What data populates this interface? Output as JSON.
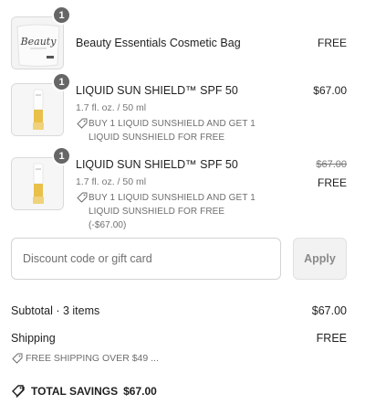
{
  "items": [
    {
      "name": "Beauty Essentials Cosmetic Bag",
      "quantity": "1",
      "price": "FREE",
      "thumb_text": "Beauty"
    },
    {
      "name": "LIQUID SUN SHIELD™ SPF 50",
      "quantity": "1",
      "variant": "1.7 fl. oz. / 50 ml",
      "promo": "BUY 1 LIQUID SUNSHIELD AND GET 1 LIQUID SUNSHIELD FOR FREE",
      "price": "$67.00"
    },
    {
      "name": "LIQUID SUN SHIELD™ SPF 50",
      "quantity": "1",
      "variant": "1.7 fl. oz. / 50 ml",
      "promo": "BUY 1 LIQUID SUNSHIELD AND GET 1 LIQUID SUNSHIELD FOR FREE (-$67.00)",
      "original_price": "$67.00",
      "price": "FREE"
    }
  ],
  "discount": {
    "placeholder": "Discount code or gift card",
    "apply_label": "Apply"
  },
  "summary": {
    "subtotal_label": "Subtotal · 3 items",
    "subtotal_value": "$67.00",
    "shipping_label": "Shipping",
    "shipping_value": "FREE",
    "shipping_promo": "FREE SHIPPING OVER $49 ...",
    "savings_label": "TOTAL SAVINGS",
    "savings_value": "$67.00"
  },
  "colors": {
    "badge": "#666666",
    "tube_accent": "#e8c04a",
    "border": "#d9d9d9"
  },
  "icons": [
    "tag-icon",
    "savings-tag-icon"
  ]
}
